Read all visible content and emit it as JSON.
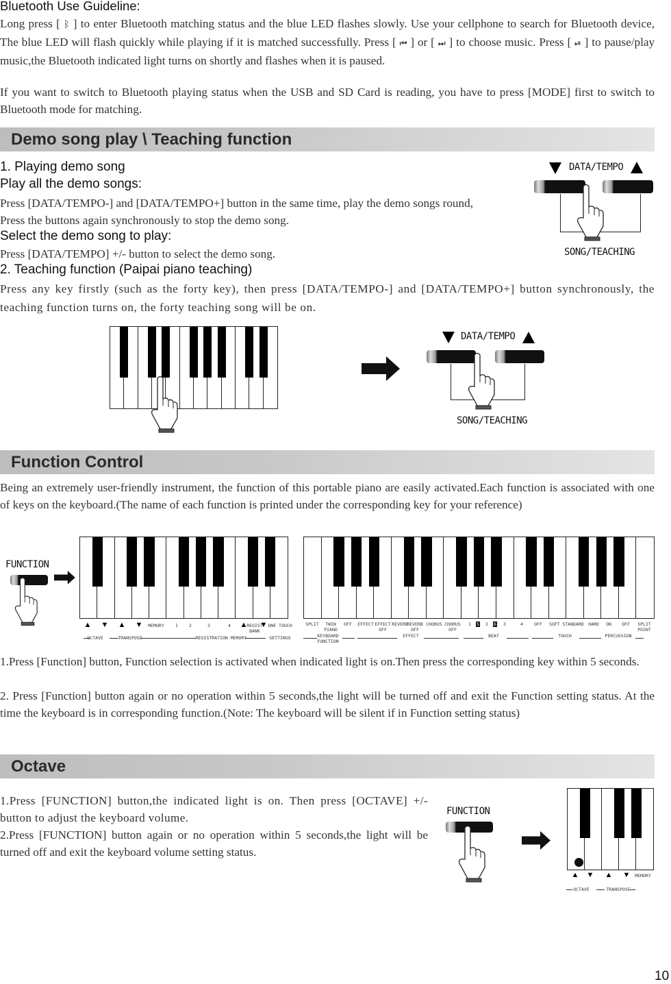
{
  "bluetooth": {
    "title": "Bluetooth Use Guideline:",
    "p1_a": "Long press [",
    "p1_b": "] to enter Bluetooth matching status and the blue LED flashes slowly. Use your cellphone to search for Bluetooth device, The blue LED will flash quickly while playing if it is matched successfully. Press [",
    "p1_c": "] or [",
    "p1_d": "] to choose music. Press [",
    "p1_e": "] to pause/play music,the Bluetooth indicated light turns on shortly and flashes when it is paused.",
    "p2": "If you want to switch to Bluetooth playing status when the USB and SD Card is reading, you have to press [MODE] first to switch to Bluetooth mode for matching.",
    "icons": [
      "bluetooth-icon",
      "previous-track-icon",
      "next-track-icon",
      "play-pause-icon"
    ]
  },
  "demo": {
    "header": "Demo song play \\ Teaching function",
    "h1": "1. Playing demo song",
    "h1_sub": "Play all the demo songs:",
    "h1_text": "Press [DATA/TEMPO-] and [DATA/TEMPO+] button in the same time, play the demo songs round, Press the buttons again synchronously to stop the demo song.",
    "h1_sub2": "Select the demo song to play:",
    "h1_text2": "Press [DATA/TEMPO] +/- button to select the demo song.",
    "h2": "2. Teaching function (Paipai piano teaching)",
    "h2_text": "Press any key firstly (such as the forty key), then press [DATA/TEMPO-] and [DATA/TEMPO+] button synchronously, the teaching function turns on, the forty teaching song will be on.",
    "figure_top_label": "DATA/TEMPO",
    "figure_bottom_label": "SONG/TEACHING"
  },
  "function_control": {
    "header": "Function Control",
    "intro": "Being an extremely user-friendly instrument, the function of this portable piano are easily activated.Each function is associated with one of keys on the keyboard.(The name of each function is printed under the corresponding key for your reference)",
    "button_label": "FUNCTION",
    "left_keys": [
      "▲",
      "▼",
      "▲",
      "▼",
      "MEMORY",
      "1",
      "2",
      "3",
      "4",
      "▲",
      "REGIST\nBANK",
      "▼",
      "ONE TOUCH"
    ],
    "left_groups": [
      "OCTAVE",
      "TRANSPOSE",
      "REGISTRATION MEMORY",
      "SETTINGS"
    ],
    "right_keys": [
      "SPLIT",
      "TWIN\nPIANO",
      "OFF",
      "EFFECT",
      "EFFECT\nOFF",
      "REVERB",
      "REVERB\nOFF",
      "CHORUS",
      "CHORUS\nOFF",
      "1",
      "5",
      "2",
      "6",
      "3",
      "4",
      "OFF",
      "SOFT",
      "STANDARD",
      "HARD",
      "ON",
      "OFF",
      "SPLIT\nPOINT"
    ],
    "right_groups": [
      "KEYBOARD\nFUNCTION",
      "EFFECT",
      "BEAT",
      "TOUCH",
      "PERCUSSION"
    ],
    "note1": "1.Press [Function] button, Function selection is activated when indicated light is on.Then press the corresponding key within 5 seconds.",
    "note2": "2. Press [Function] button again or no operation within 5 seconds,the light will be turned off and exit the Function setting status. At the time the keyboard is in corresponding function.(Note: The keyboard will be silent if in Function setting status)"
  },
  "octave": {
    "header": "Octave",
    "text1": "1.Press [FUNCTION] button,the indicated light is on. Then press [OCTAVE] +/- button to adjust the keyboard volume.",
    "text2": "2.Press [FUNCTION] button again or no operation within 5 seconds,the light will be turned off and exit the keyboard volume setting status.",
    "button_label": "FUNCTION",
    "keys": [
      "▲",
      "▼",
      "▲",
      "▼",
      "MEMORY"
    ],
    "groups": [
      "OCTAVE",
      "TRANSPOSE"
    ]
  },
  "page_number": "10"
}
